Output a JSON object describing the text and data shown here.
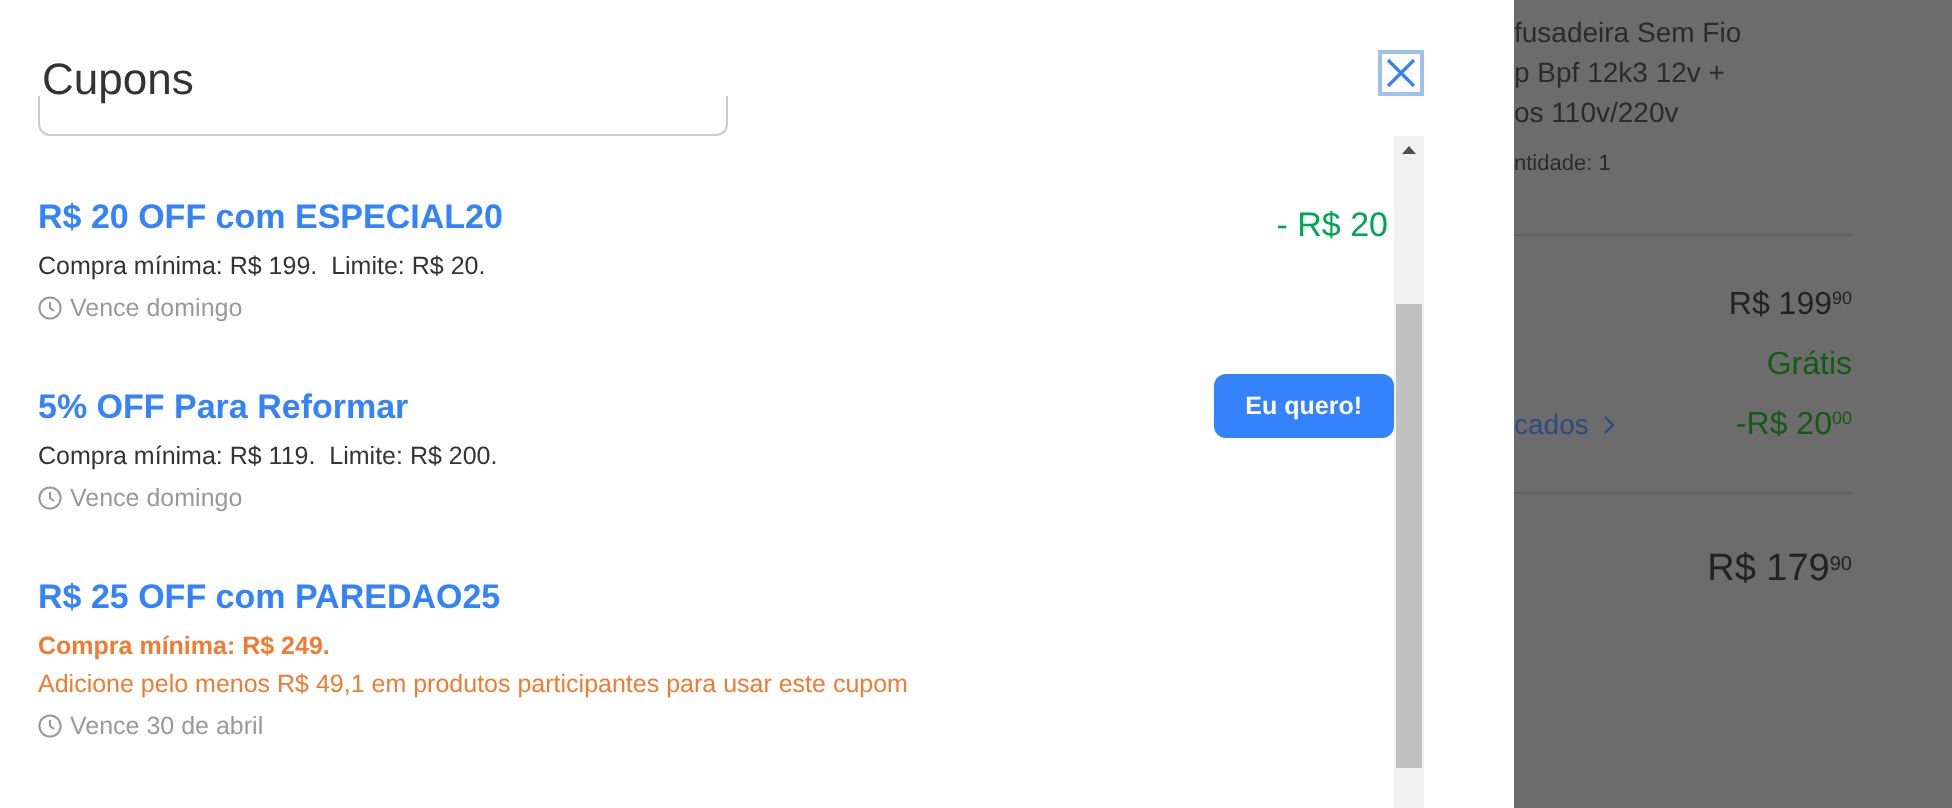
{
  "modal": {
    "title": "Cupons",
    "coupons": [
      {
        "title": "R$ 20 OFF com ESPECIAL20",
        "conditions": [
          {
            "kind": "normal",
            "text": "Compra mínima: R$ 199.  Limite: R$ 20."
          }
        ],
        "expiry": "Vence domingo",
        "action": {
          "kind": "discount",
          "text": "- R$ 20"
        }
      },
      {
        "title": "5% OFF Para Reformar",
        "conditions": [
          {
            "kind": "normal",
            "text": "Compra mínima: R$ 119.  Limite: R$ 200."
          }
        ],
        "expiry": "Vence domingo",
        "action": {
          "kind": "button",
          "text": "Eu quero!"
        }
      },
      {
        "title": "R$ 25 OFF com PAREDAO25",
        "conditions": [
          {
            "kind": "warning-bold",
            "text": "Compra mínima: R$ 249."
          },
          {
            "kind": "warning",
            "text": "Adicione pelo menos R$ 49,1 em produtos participantes para usar este cupom"
          }
        ],
        "expiry": "Vence 30 de abril"
      }
    ]
  },
  "background": {
    "product_title": [
      "fusadeira Sem Fio",
      "p Bpf 12k3 12v +",
      "os 110v/220v"
    ],
    "quantity": "ntidade: 1",
    "summary": [
      {
        "kind": "price",
        "value": "R$ 199$^{90}$"
      },
      {
        "kind": "free",
        "value": "Grátis"
      },
      {
        "kind": "discount",
        "link": "cados",
        "value": "-R$ 20$^{00}$"
      }
    ],
    "total": "R$ 179$^{90}$"
  }
}
